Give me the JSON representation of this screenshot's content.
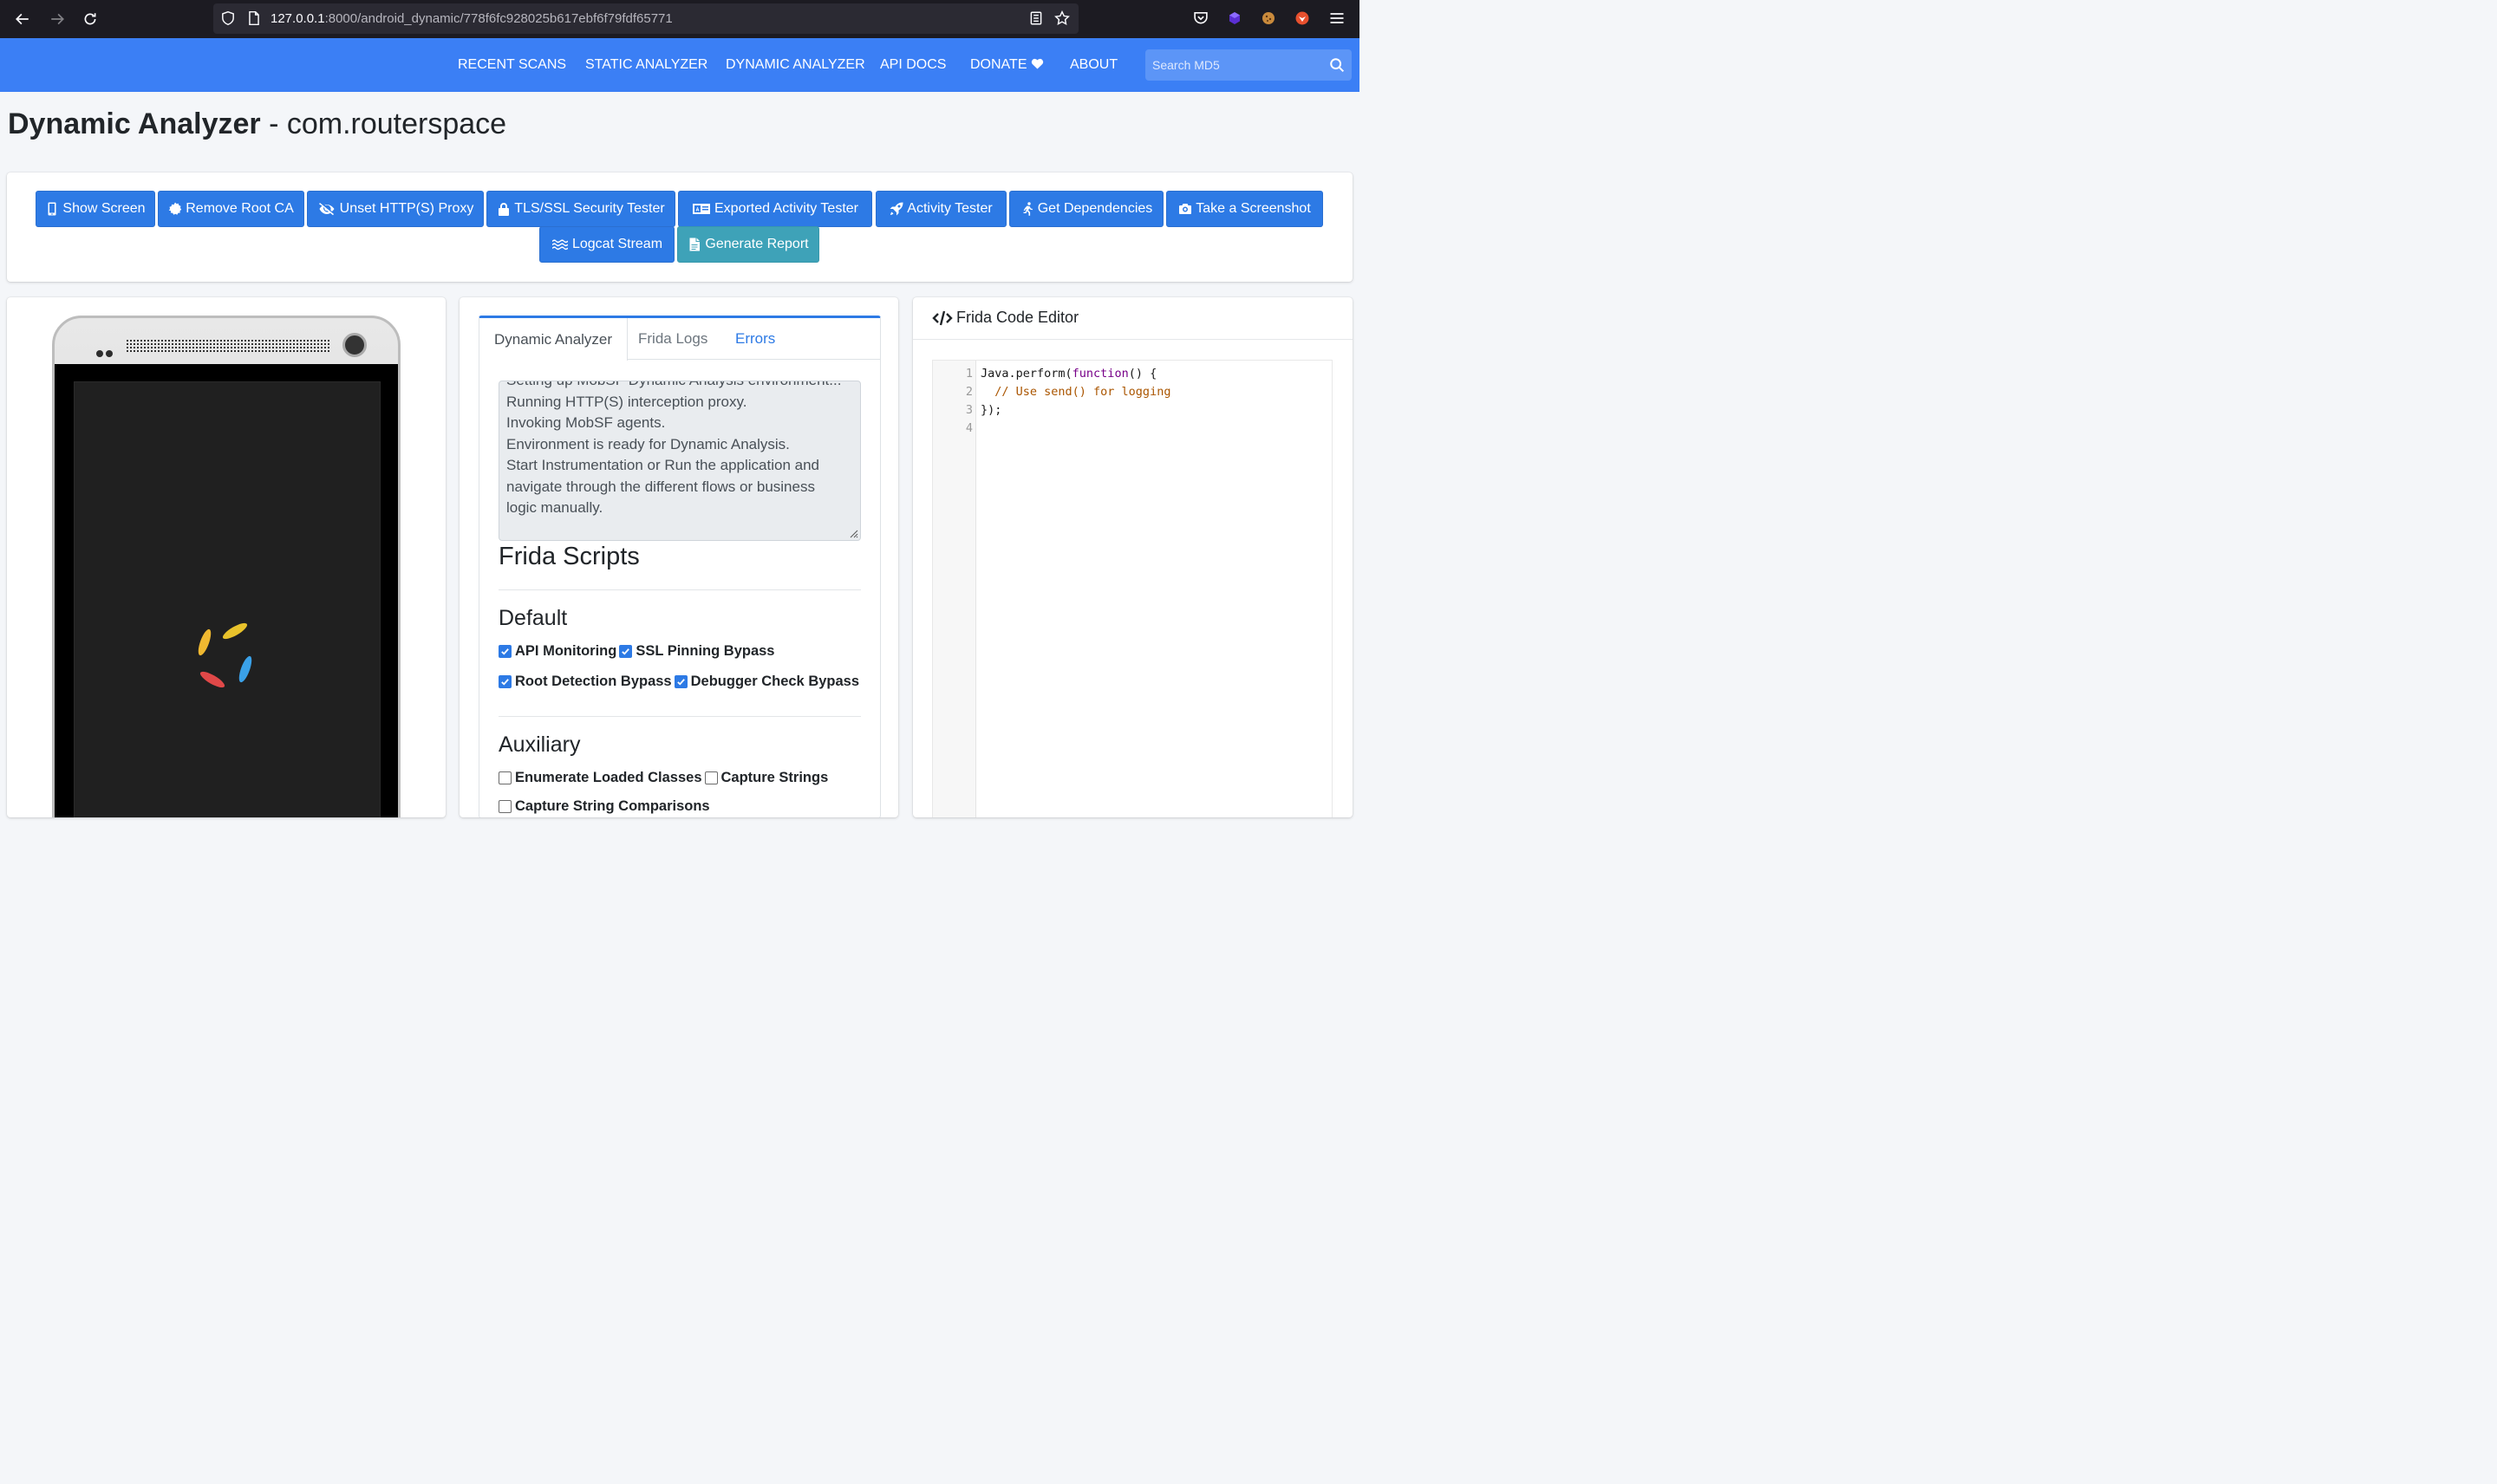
{
  "browser": {
    "url_host": "127.0.0.1",
    "url_rest": ":8000/android_dynamic/778f6fc928025b617ebf6f79fdf65771"
  },
  "navbar": {
    "links": [
      "RECENT SCANS",
      "STATIC ANALYZER",
      "DYNAMIC ANALYZER",
      "API DOCS",
      "DONATE",
      "ABOUT"
    ],
    "search_placeholder": "Search MD5"
  },
  "page": {
    "title_bold": "Dynamic Analyzer",
    "title_rest": " - com.routerspace"
  },
  "actions": [
    {
      "label": "Show Screen",
      "icon": "mobile-icon",
      "style": "primary"
    },
    {
      "label": "Remove Root CA",
      "icon": "certificate-icon",
      "style": "primary"
    },
    {
      "label": "Unset HTTP(S) Proxy",
      "icon": "eye-slash-icon",
      "style": "primary"
    },
    {
      "label": "TLS/SSL Security Tester",
      "icon": "lock-icon",
      "style": "primary"
    },
    {
      "label": "Exported Activity Tester",
      "icon": "id-card-icon",
      "style": "primary"
    },
    {
      "label": "Activity Tester",
      "icon": "rocket-icon",
      "style": "primary"
    },
    {
      "label": "Get Dependencies",
      "icon": "running-icon",
      "style": "primary"
    },
    {
      "label": "Take a Screenshot",
      "icon": "camera-icon",
      "style": "primary"
    },
    {
      "label": "Logcat Stream",
      "icon": "stream-icon",
      "style": "primary"
    },
    {
      "label": "Generate Report",
      "icon": "file-icon",
      "style": "info"
    }
  ],
  "tabs": [
    "Dynamic Analyzer",
    "Frida Logs",
    "Errors"
  ],
  "log": {
    "lines": [
      "Setting up MobSF Dynamic Analysis environment...",
      "Running HTTP(S) interception proxy.",
      "Invoking MobSF agents.",
      "Environment is ready for Dynamic Analysis.",
      "Start Instrumentation or Run the application and",
      "navigate through the different flows or business",
      "logic manually."
    ]
  },
  "frida": {
    "heading": "Frida Scripts",
    "default_heading": "Default",
    "default_scripts": [
      {
        "label": "API Monitoring",
        "checked": true
      },
      {
        "label": "SSL Pinning Bypass",
        "checked": true
      },
      {
        "label": "Root Detection Bypass",
        "checked": true
      },
      {
        "label": "Debugger Check Bypass",
        "checked": true
      }
    ],
    "aux_heading": "Auxiliary",
    "aux_scripts": [
      {
        "label": "Enumerate Loaded Classes",
        "checked": false
      },
      {
        "label": "Capture Strings",
        "checked": false
      },
      {
        "label": "Capture String Comparisons",
        "checked": false
      }
    ]
  },
  "editor": {
    "title": "Frida Code Editor",
    "line_numbers": [
      "1",
      "2",
      "3",
      "4"
    ],
    "code": {
      "l1_a": "Java.perform(",
      "l1_kw": "function",
      "l1_b": "() {",
      "l2": "  // Use send() for logging",
      "l3": "});"
    }
  }
}
